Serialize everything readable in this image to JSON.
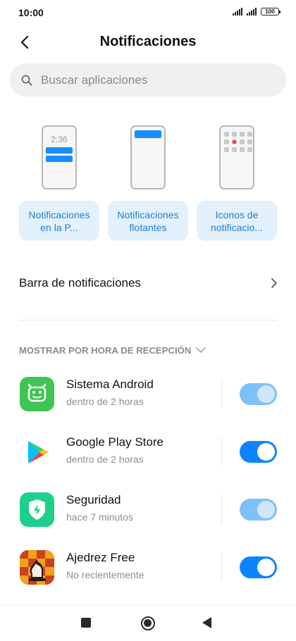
{
  "status_bar": {
    "time": "10:00",
    "battery": "100",
    "icons": [
      "signal-icon",
      "signal-icon",
      "battery-icon"
    ]
  },
  "header": {
    "title": "Notificaciones",
    "back_icon": "chevron-left-icon"
  },
  "search": {
    "placeholder": "Buscar aplicaciones",
    "icon": "search-icon"
  },
  "notification_styles": [
    {
      "label": "Notificaciones en la P...",
      "preview_time": "2:36"
    },
    {
      "label": "Notificaciones flotantes"
    },
    {
      "label": "Iconos de notificacio..."
    }
  ],
  "notification_bar": {
    "label": "Barra de notificaciones",
    "icon": "chevron-right-icon"
  },
  "section": {
    "label": "MOSTRAR POR HORA DE RECEPCIÓN",
    "icon": "chevron-down-icon"
  },
  "apps": [
    {
      "name": "Sistema Android",
      "subtitle": "dentro de 2 horas",
      "icon": "android-icon",
      "enabled": true,
      "dimmed": true
    },
    {
      "name": "Google Play Store",
      "subtitle": "dentro de 2 horas",
      "icon": "play-store-icon",
      "enabled": true,
      "dimmed": false
    },
    {
      "name": "Seguridad",
      "subtitle": "hace 7 minutos",
      "icon": "security-shield-icon",
      "enabled": true,
      "dimmed": true
    },
    {
      "name": "Ajedrez Free",
      "subtitle": "No recientemente",
      "icon": "chess-icon",
      "enabled": true,
      "dimmed": false
    }
  ],
  "nav_bar": {
    "icons": [
      "recents-icon",
      "home-icon",
      "back-icon"
    ]
  },
  "colors": {
    "accent": "#0d84ff",
    "accent_dim": "#7ec0f8",
    "style_button_bg": "#e3f1fc",
    "style_button_text": "#1f7fd1"
  }
}
